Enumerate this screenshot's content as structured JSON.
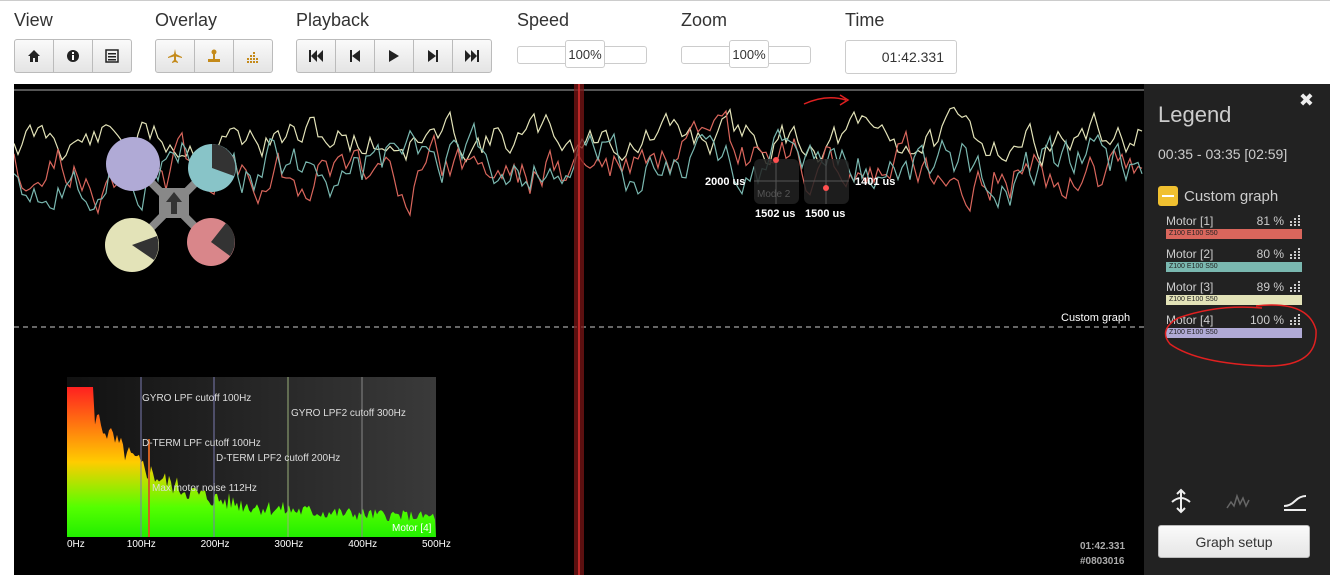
{
  "toolbar": {
    "view": {
      "label": "View"
    },
    "overlay": {
      "label": "Overlay"
    },
    "playback": {
      "label": "Playback"
    },
    "speed": {
      "label": "Speed",
      "value": "100%",
      "level": 0.5
    },
    "zoom": {
      "label": "Zoom",
      "value": "100%",
      "level": 0.5
    },
    "time": {
      "label": "Time",
      "value": "01:42.331"
    }
  },
  "graph": {
    "motor_labels": {
      "top_left": "2000 us",
      "top_right": "1401 us",
      "bottom_left": "1502 us",
      "bottom_right": "1500 us",
      "mode": "Mode 2"
    },
    "custom_graph_label": "Custom graph",
    "spectrum": {
      "annotations": {
        "gyro_lpf": "GYRO LPF cutoff 100Hz",
        "gyro_lpf2": "GYRO LPF2 cutoff 300Hz",
        "dterm_lpf": "D-TERM LPF cutoff 100Hz",
        "dterm_lpf2": "D-TERM LPF2 cutoff 200Hz",
        "max_noise": "Max motor noise 112Hz"
      },
      "series_label": "Motor [4]",
      "x_ticks": [
        "0Hz",
        "100Hz",
        "200Hz",
        "300Hz",
        "400Hz",
        "500Hz"
      ]
    },
    "timestamp": "01:42.331",
    "frame": "#0803016",
    "colors": {
      "motor1": "#d9665c",
      "motor2": "#7ab8b0",
      "motor3": "#e3e3b8",
      "motor4": "#b0aad6"
    }
  },
  "legend": {
    "title": "Legend",
    "range": "00:35 - 03:35 [02:59]",
    "group": "Custom graph",
    "motors": [
      {
        "name": "Motor [1]",
        "pct": "81 %",
        "tag": "Z100 E100 S50",
        "color": "#d9665c"
      },
      {
        "name": "Motor [2]",
        "pct": "80 %",
        "tag": "Z100 E100 S50",
        "color": "#7ab8b0"
      },
      {
        "name": "Motor [3]",
        "pct": "89 %",
        "tag": "Z100 E100 S50",
        "color": "#e3e3b8"
      },
      {
        "name": "Motor [4]",
        "pct": "100 %",
        "tag": "Z100 E100 S50",
        "color": "#b0aad6"
      }
    ],
    "setup_button": "Graph setup"
  }
}
